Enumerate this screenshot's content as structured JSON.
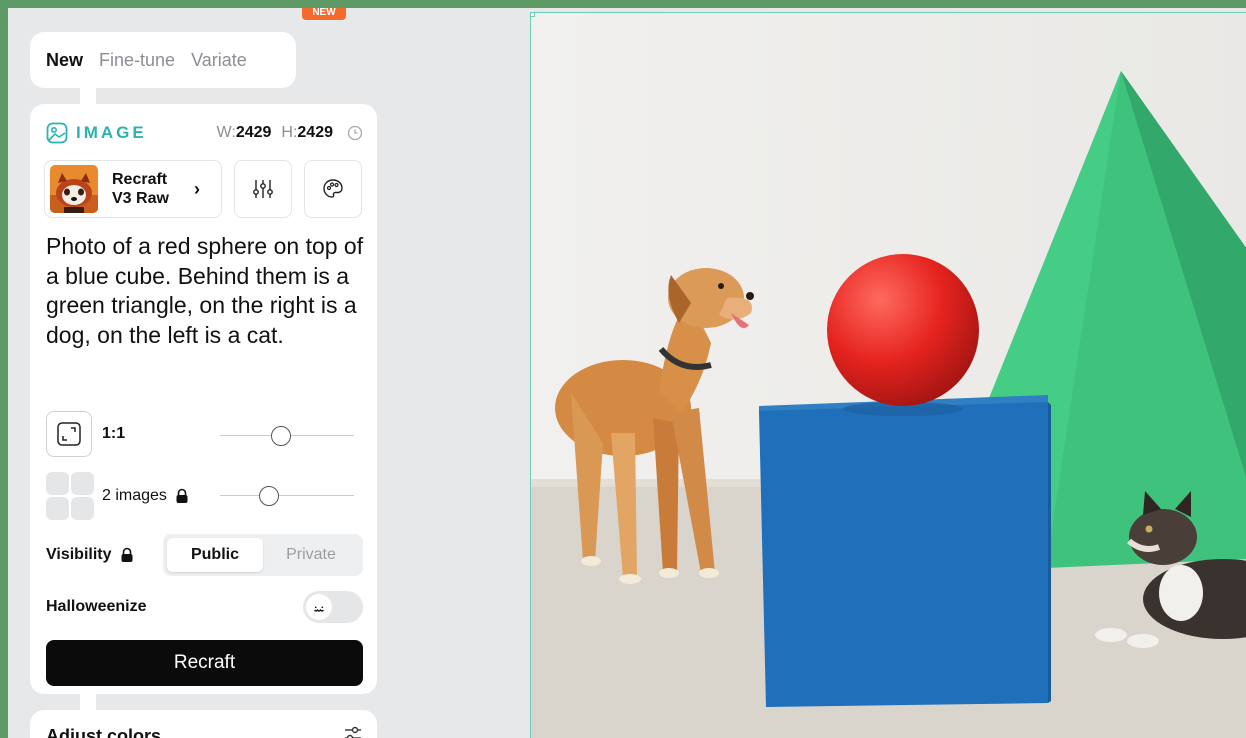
{
  "badge": "NEW",
  "tabs": [
    {
      "label": "New",
      "active": true
    },
    {
      "label": "Fine-tune",
      "active": false
    },
    {
      "label": "Variate",
      "active": false
    }
  ],
  "image_panel": {
    "type_label": "IMAGE",
    "width_key": "W:",
    "width_value": "2429",
    "height_key": "H:",
    "height_value": "2429",
    "model_line1": "Recraft",
    "model_line2": "V3 Raw",
    "prompt": "Photo of a red sphere on top of a blue cube. Behind them is a green triangle, on the right is a dog, on the left is a cat.",
    "ratio_label": "1:1",
    "ratio_slider_fraction": 0.45,
    "images_label": "2 images",
    "images_slider_fraction": 0.34,
    "visibility_label": "Visibility",
    "visibility_options": [
      "Public",
      "Private"
    ],
    "visibility_selected": "Public",
    "halloweenize_label": "Halloweenize",
    "halloweenize_on": false,
    "generate_label": "Recraft"
  },
  "adjust_colors": {
    "label": "Adjust colors"
  },
  "icons": {
    "image": "image-icon",
    "clock": "clock-icon",
    "sliders": "sliders-icon",
    "palette": "palette-icon",
    "lock": "lock-icon",
    "aspect": "aspect-ratio-icon",
    "grid": "grid-icon",
    "pumpkin": "pumpkin-icon",
    "adjust": "adjust-icon"
  },
  "colors": {
    "accent": "#2ab3b0",
    "primary_button": "#0b0b0b",
    "badge": "#f26a2e",
    "canvas_border": "#6ccdb8"
  }
}
